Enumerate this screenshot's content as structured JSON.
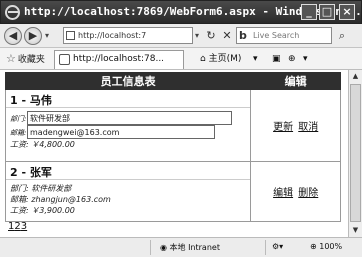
{
  "window": {
    "title": "http://localhost:7869/WebForm6.aspx - Windows Int...",
    "minimize_glyph": "_",
    "maximize_glyph": "□",
    "close_glyph": "×"
  },
  "address_bar": {
    "back_glyph": "◀",
    "forward_glyph": "▶",
    "dropdown_glyph": "▾",
    "url": "http://localhost:7",
    "refresh_glyph": "↻",
    "stop_glyph": "✕",
    "search_placeholder": "Live Search",
    "search_logo": "b",
    "search_go_glyph": "⌕"
  },
  "favorites_bar": {
    "favorites_label": "收藏夹",
    "tab_title": "http://localhost:78...",
    "home_label": "主页(M)",
    "extra_labels": [
      "▾",
      "▣",
      "⊕",
      "▾"
    ]
  },
  "grid": {
    "header_info": "员工信息表",
    "header_edit": "编辑",
    "employees": [
      {
        "title": "1 - 马伟",
        "mode": "edit",
        "dept_label": "部门:",
        "dept_value": "软件研发部",
        "email_label": "邮箱:",
        "email_value": "madengwei@163.com",
        "salary_label": "工资:",
        "salary_value": "￥4,800.00",
        "actions": [
          "更新",
          "取消"
        ]
      },
      {
        "title": "2 - 张军",
        "mode": "view",
        "dept_label": "部门:",
        "dept_value": "软件研发部",
        "email_label": "邮箱:",
        "email_value": "zhangjun@163.com",
        "salary_label": "工资:",
        "salary_value": "￥3,900.00",
        "actions": [
          "编辑",
          "删除"
        ]
      }
    ],
    "pager": [
      "1",
      "2",
      "3"
    ]
  },
  "status_bar": {
    "zone": "本地 Intranet",
    "zoom": "100%"
  },
  "colors": {
    "header_bg": "#2f2f2f",
    "chrome_bg": "#ececec"
  }
}
